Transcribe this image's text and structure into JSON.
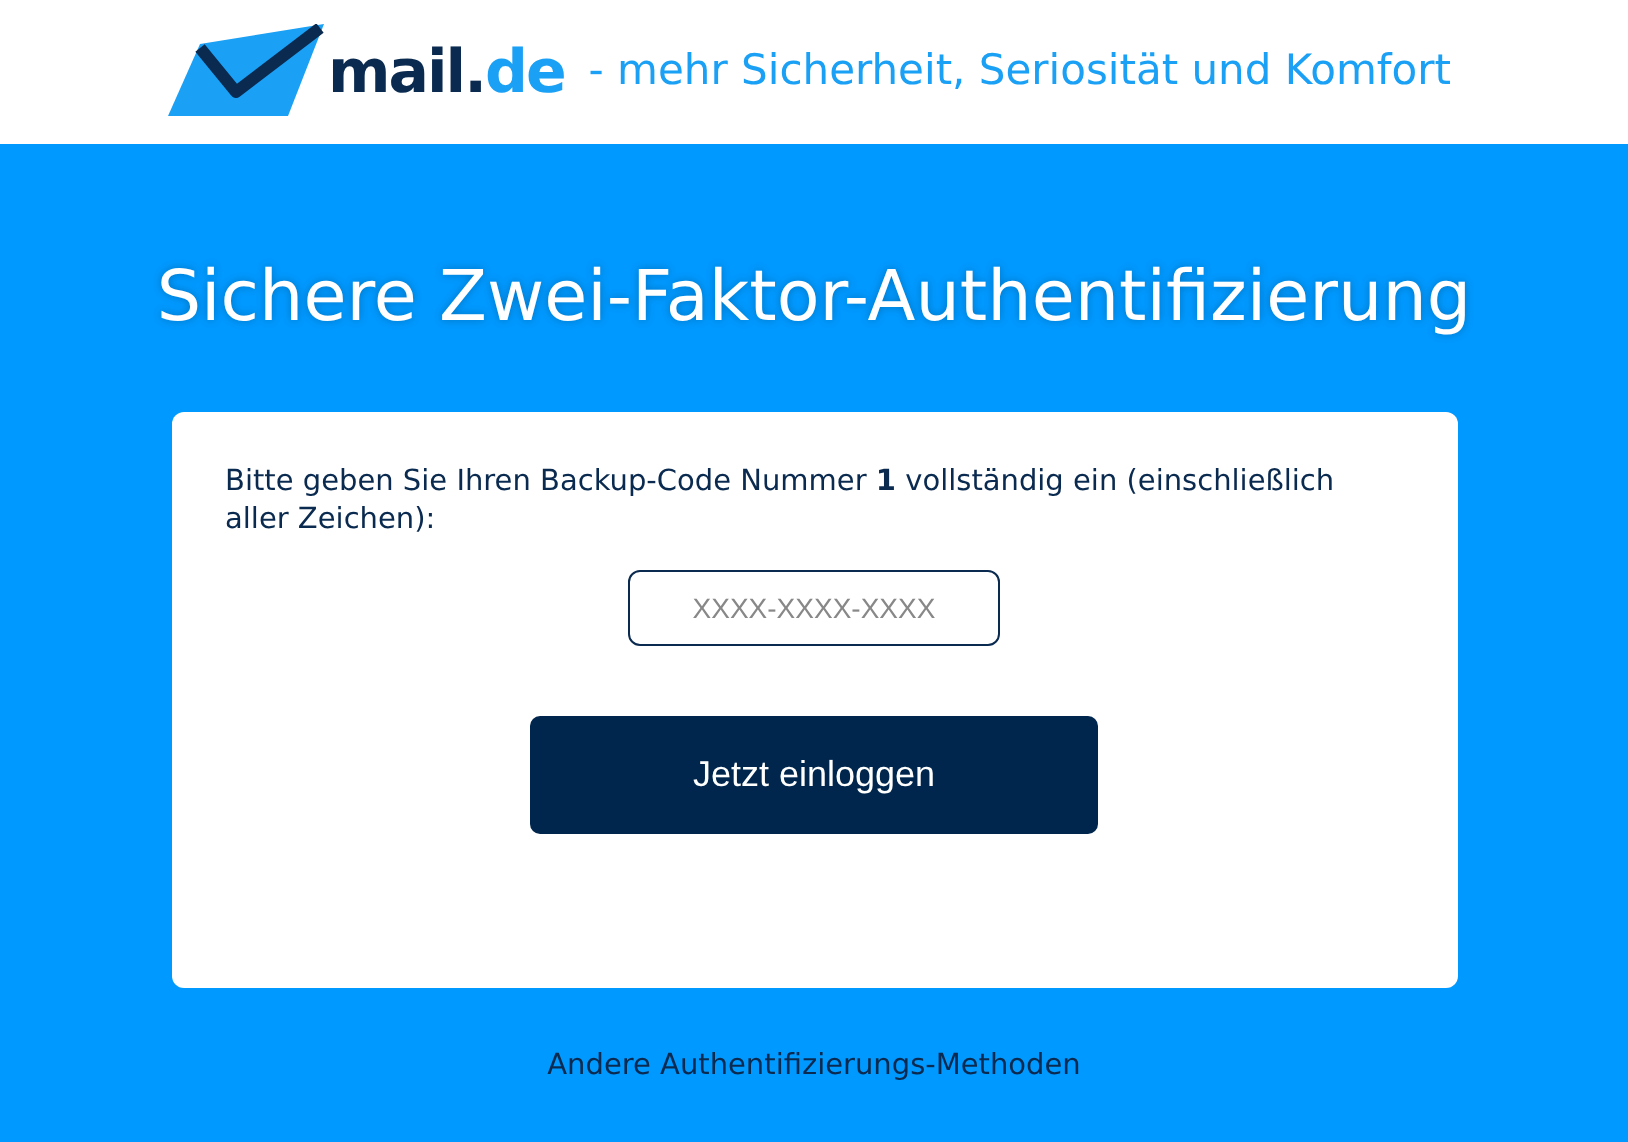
{
  "header": {
    "logo": {
      "main": "mail.",
      "accent": "de"
    },
    "tagline": "- mehr Sicherheit, Seriosität und Komfort"
  },
  "title": "Sichere Zwei-Faktor-Authentifizierung",
  "form": {
    "instruction": "Bitte geben Sie Ihren Backup-Code Nummer **1** vollständig ein (einschließlich aller Zeichen):",
    "code_field": {
      "placeholder": "XXXX-XXXX-XXXX"
    },
    "submit": "Jetzt einloggen"
  },
  "other_methods_link": "Andere Authentifizierungs-Methoden"
}
